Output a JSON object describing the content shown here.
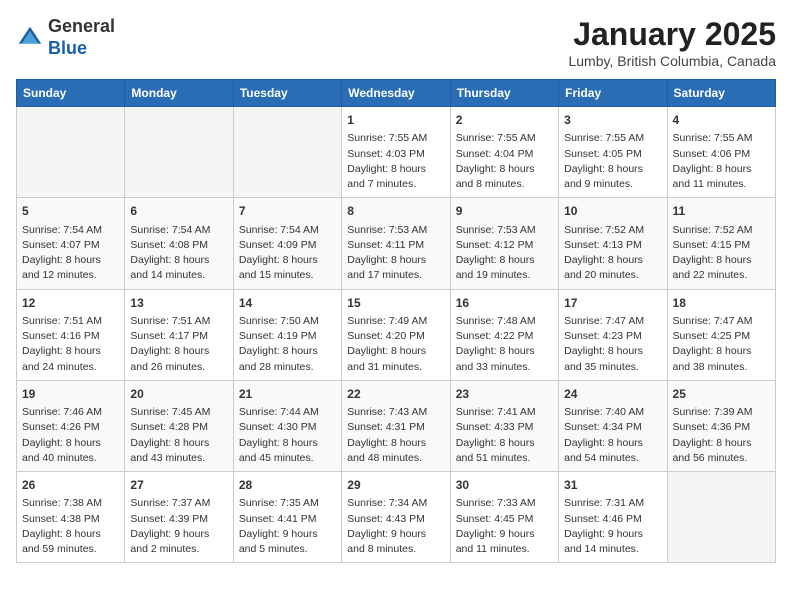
{
  "logo": {
    "general": "General",
    "blue": "Blue"
  },
  "title": "January 2025",
  "subtitle": "Lumby, British Columbia, Canada",
  "days_of_week": [
    "Sunday",
    "Monday",
    "Tuesday",
    "Wednesday",
    "Thursday",
    "Friday",
    "Saturday"
  ],
  "weeks": [
    [
      {
        "day": "",
        "sunrise": "",
        "sunset": "",
        "daylight": "",
        "empty": true
      },
      {
        "day": "",
        "sunrise": "",
        "sunset": "",
        "daylight": "",
        "empty": true
      },
      {
        "day": "",
        "sunrise": "",
        "sunset": "",
        "daylight": "",
        "empty": true
      },
      {
        "day": "1",
        "sunrise": "Sunrise: 7:55 AM",
        "sunset": "Sunset: 4:03 PM",
        "daylight": "Daylight: 8 hours and 7 minutes.",
        "empty": false
      },
      {
        "day": "2",
        "sunrise": "Sunrise: 7:55 AM",
        "sunset": "Sunset: 4:04 PM",
        "daylight": "Daylight: 8 hours and 8 minutes.",
        "empty": false
      },
      {
        "day": "3",
        "sunrise": "Sunrise: 7:55 AM",
        "sunset": "Sunset: 4:05 PM",
        "daylight": "Daylight: 8 hours and 9 minutes.",
        "empty": false
      },
      {
        "day": "4",
        "sunrise": "Sunrise: 7:55 AM",
        "sunset": "Sunset: 4:06 PM",
        "daylight": "Daylight: 8 hours and 11 minutes.",
        "empty": false
      }
    ],
    [
      {
        "day": "5",
        "sunrise": "Sunrise: 7:54 AM",
        "sunset": "Sunset: 4:07 PM",
        "daylight": "Daylight: 8 hours and 12 minutes.",
        "empty": false
      },
      {
        "day": "6",
        "sunrise": "Sunrise: 7:54 AM",
        "sunset": "Sunset: 4:08 PM",
        "daylight": "Daylight: 8 hours and 14 minutes.",
        "empty": false
      },
      {
        "day": "7",
        "sunrise": "Sunrise: 7:54 AM",
        "sunset": "Sunset: 4:09 PM",
        "daylight": "Daylight: 8 hours and 15 minutes.",
        "empty": false
      },
      {
        "day": "8",
        "sunrise": "Sunrise: 7:53 AM",
        "sunset": "Sunset: 4:11 PM",
        "daylight": "Daylight: 8 hours and 17 minutes.",
        "empty": false
      },
      {
        "day": "9",
        "sunrise": "Sunrise: 7:53 AM",
        "sunset": "Sunset: 4:12 PM",
        "daylight": "Daylight: 8 hours and 19 minutes.",
        "empty": false
      },
      {
        "day": "10",
        "sunrise": "Sunrise: 7:52 AM",
        "sunset": "Sunset: 4:13 PM",
        "daylight": "Daylight: 8 hours and 20 minutes.",
        "empty": false
      },
      {
        "day": "11",
        "sunrise": "Sunrise: 7:52 AM",
        "sunset": "Sunset: 4:15 PM",
        "daylight": "Daylight: 8 hours and 22 minutes.",
        "empty": false
      }
    ],
    [
      {
        "day": "12",
        "sunrise": "Sunrise: 7:51 AM",
        "sunset": "Sunset: 4:16 PM",
        "daylight": "Daylight: 8 hours and 24 minutes.",
        "empty": false
      },
      {
        "day": "13",
        "sunrise": "Sunrise: 7:51 AM",
        "sunset": "Sunset: 4:17 PM",
        "daylight": "Daylight: 8 hours and 26 minutes.",
        "empty": false
      },
      {
        "day": "14",
        "sunrise": "Sunrise: 7:50 AM",
        "sunset": "Sunset: 4:19 PM",
        "daylight": "Daylight: 8 hours and 28 minutes.",
        "empty": false
      },
      {
        "day": "15",
        "sunrise": "Sunrise: 7:49 AM",
        "sunset": "Sunset: 4:20 PM",
        "daylight": "Daylight: 8 hours and 31 minutes.",
        "empty": false
      },
      {
        "day": "16",
        "sunrise": "Sunrise: 7:48 AM",
        "sunset": "Sunset: 4:22 PM",
        "daylight": "Daylight: 8 hours and 33 minutes.",
        "empty": false
      },
      {
        "day": "17",
        "sunrise": "Sunrise: 7:47 AM",
        "sunset": "Sunset: 4:23 PM",
        "daylight": "Daylight: 8 hours and 35 minutes.",
        "empty": false
      },
      {
        "day": "18",
        "sunrise": "Sunrise: 7:47 AM",
        "sunset": "Sunset: 4:25 PM",
        "daylight": "Daylight: 8 hours and 38 minutes.",
        "empty": false
      }
    ],
    [
      {
        "day": "19",
        "sunrise": "Sunrise: 7:46 AM",
        "sunset": "Sunset: 4:26 PM",
        "daylight": "Daylight: 8 hours and 40 minutes.",
        "empty": false
      },
      {
        "day": "20",
        "sunrise": "Sunrise: 7:45 AM",
        "sunset": "Sunset: 4:28 PM",
        "daylight": "Daylight: 8 hours and 43 minutes.",
        "empty": false
      },
      {
        "day": "21",
        "sunrise": "Sunrise: 7:44 AM",
        "sunset": "Sunset: 4:30 PM",
        "daylight": "Daylight: 8 hours and 45 minutes.",
        "empty": false
      },
      {
        "day": "22",
        "sunrise": "Sunrise: 7:43 AM",
        "sunset": "Sunset: 4:31 PM",
        "daylight": "Daylight: 8 hours and 48 minutes.",
        "empty": false
      },
      {
        "day": "23",
        "sunrise": "Sunrise: 7:41 AM",
        "sunset": "Sunset: 4:33 PM",
        "daylight": "Daylight: 8 hours and 51 minutes.",
        "empty": false
      },
      {
        "day": "24",
        "sunrise": "Sunrise: 7:40 AM",
        "sunset": "Sunset: 4:34 PM",
        "daylight": "Daylight: 8 hours and 54 minutes.",
        "empty": false
      },
      {
        "day": "25",
        "sunrise": "Sunrise: 7:39 AM",
        "sunset": "Sunset: 4:36 PM",
        "daylight": "Daylight: 8 hours and 56 minutes.",
        "empty": false
      }
    ],
    [
      {
        "day": "26",
        "sunrise": "Sunrise: 7:38 AM",
        "sunset": "Sunset: 4:38 PM",
        "daylight": "Daylight: 8 hours and 59 minutes.",
        "empty": false
      },
      {
        "day": "27",
        "sunrise": "Sunrise: 7:37 AM",
        "sunset": "Sunset: 4:39 PM",
        "daylight": "Daylight: 9 hours and 2 minutes.",
        "empty": false
      },
      {
        "day": "28",
        "sunrise": "Sunrise: 7:35 AM",
        "sunset": "Sunset: 4:41 PM",
        "daylight": "Daylight: 9 hours and 5 minutes.",
        "empty": false
      },
      {
        "day": "29",
        "sunrise": "Sunrise: 7:34 AM",
        "sunset": "Sunset: 4:43 PM",
        "daylight": "Daylight: 9 hours and 8 minutes.",
        "empty": false
      },
      {
        "day": "30",
        "sunrise": "Sunrise: 7:33 AM",
        "sunset": "Sunset: 4:45 PM",
        "daylight": "Daylight: 9 hours and 11 minutes.",
        "empty": false
      },
      {
        "day": "31",
        "sunrise": "Sunrise: 7:31 AM",
        "sunset": "Sunset: 4:46 PM",
        "daylight": "Daylight: 9 hours and 14 minutes.",
        "empty": false
      },
      {
        "day": "",
        "sunrise": "",
        "sunset": "",
        "daylight": "",
        "empty": true
      }
    ]
  ]
}
